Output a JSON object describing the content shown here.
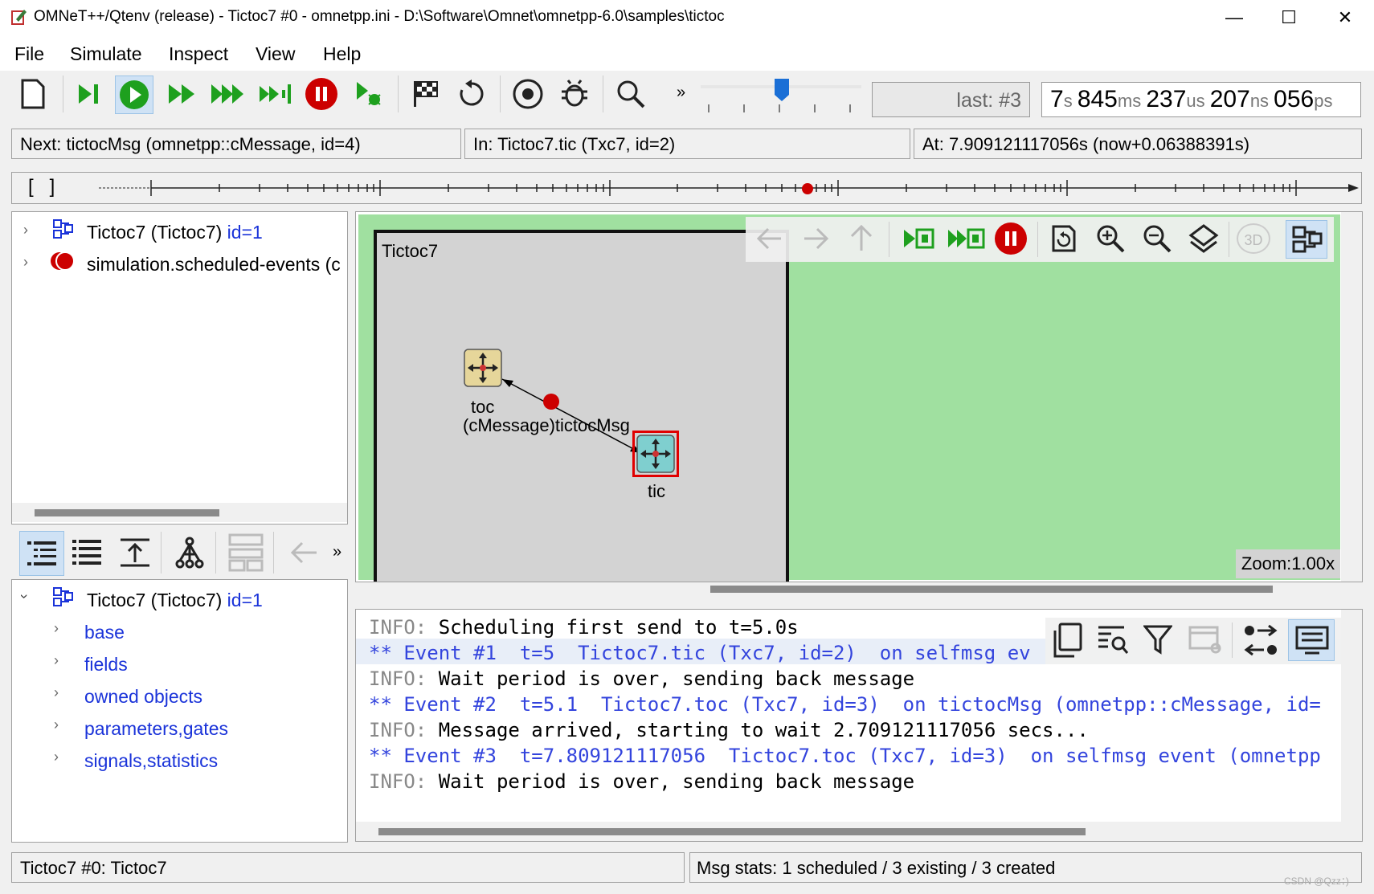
{
  "window": {
    "title": "OMNeT++/Qtenv (release) - Tictoc7 #0 - omnetpp.ini - D:\\Software\\Omnet\\omnetpp-6.0\\samples\\tictoc",
    "minimize": "—",
    "maximize": "☐",
    "close": "✕"
  },
  "menu": [
    "File",
    "Simulate",
    "Inspect",
    "View",
    "Help"
  ],
  "toolbar": {
    "last_event": "last: #3",
    "sim_time": {
      "s": "7",
      "ms": "845",
      "us": "237",
      "ns": "207",
      "ps": "056"
    },
    "more": "»"
  },
  "info": {
    "next": "Next: tictocMsg (omnetpp::cMessage, id=4)",
    "in": "In: Tictoc7.tic (Txc7, id=2)",
    "at": "At: 7.909121117056s (now+0.06388391s)"
  },
  "timeline": {
    "brackets": "[   ]"
  },
  "object_tree": [
    {
      "label": "Tictoc7 (Tictoc7)",
      "id": "id=1"
    },
    {
      "label": "simulation.scheduled-events (c"
    }
  ],
  "inspector_toolbar_more": "»",
  "inspector_tree": {
    "root_label": "Tictoc7 (Tictoc7)",
    "root_id": "id=1",
    "children": [
      "base",
      "fields",
      "owned objects",
      "parameters,gates",
      "signals,statistics"
    ]
  },
  "network": {
    "name": "Tictoc7",
    "toc_label": "toc",
    "tic_label": "tic",
    "msg_label": "(cMessage)tictocMsg",
    "zoom": "Zoom:1.00x",
    "btn_3d": "3D"
  },
  "log": [
    {
      "kind": "info",
      "prefix": "INFO:",
      "text": " Scheduling first send to t=5.0s"
    },
    {
      "kind": "event",
      "text": "** Event #1  t=5  Tictoc7.tic (Txc7, id=2)  on selfmsg ev"
    },
    {
      "kind": "info",
      "prefix": "INFO:",
      "text": " Wait period is over, sending back message"
    },
    {
      "kind": "event",
      "text": "** Event #2  t=5.1  Tictoc7.toc (Txc7, id=3)  on tictocMsg (omnetpp::cMessage, id="
    },
    {
      "kind": "info",
      "prefix": "INFO:",
      "text": " Message arrived, starting to wait 2.709121117056 secs..."
    },
    {
      "kind": "event",
      "text": "** Event #3  t=7.809121117056  Tictoc7.toc (Txc7, id=3)  on selfmsg event (omnetpp"
    },
    {
      "kind": "info",
      "prefix": "INFO:",
      "text": " Wait period is over, sending back message"
    }
  ],
  "status": {
    "left": "Tictoc7 #0: Tictoc7",
    "right": "Msg stats: 1 scheduled / 3 existing / 3 created",
    "watermark": "CSDN @Qzz：)"
  },
  "colors": {
    "green_bg": "#a0e0a0",
    "canvas_gray": "#d3d3d3",
    "red": "#d00000",
    "play_green": "#1ea01e"
  }
}
